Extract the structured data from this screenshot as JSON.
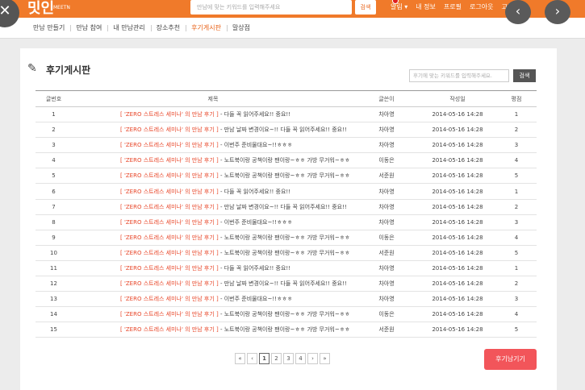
{
  "header": {
    "logo": "밋인",
    "logo_sub": "MEETN",
    "search_placeholder": "만남에 맞는 키워드를 입력해주세요",
    "search_button": "검색",
    "nav": [
      "알림 ▾",
      "내 정보",
      "프로필",
      "로그아웃",
      "고객센터"
    ]
  },
  "subnav": {
    "items": [
      "만남 만들기",
      "만남 참여",
      "내 만남관리",
      "장소추천",
      "후기게시판",
      "말상점"
    ],
    "active_index": 4
  },
  "board": {
    "title": "후기게시판",
    "search_placeholder": "후기에 맞는 키워드를 입력해주세요.",
    "search_button": "검색",
    "columns": [
      "글번호",
      "제목",
      "글쓴이",
      "작성일",
      "평점"
    ],
    "rows": [
      {
        "num": "1",
        "tag": "[ 'ZERO 스트레스 세미나' 의 만남 후기 ]",
        "text": " - 다들 꼭 읽어주세요!! 중요!!",
        "author": "차아영",
        "date": "2014-05-16 14:28",
        "score": "1"
      },
      {
        "num": "2",
        "tag": "[ 'ZERO 스트레스 세미나' 의 만남 후기 ]",
        "text": " - 만남 날짜 변경이요~!! 다들 꼭 읽어주세요!! 중요!!",
        "author": "차아영",
        "date": "2014-05-16 14:28",
        "score": "2"
      },
      {
        "num": "3",
        "tag": "[ 'ZERO 스트레스 세미나' 의 만남 후기 ]",
        "text": " - 이번주 준비물대요~!!ㅎㅎㅎ",
        "author": "차아영",
        "date": "2014-05-16 14:28",
        "score": "3"
      },
      {
        "num": "4",
        "tag": "[ 'ZERO 스트레스 세미나' 의 만남 후기 ]",
        "text": " - 노트북이랑 공책이랑 팬이랑~ㅎㅎ 가방 무거워~ㅎㅎ",
        "author": "이동은",
        "date": "2014-05-16 14:28",
        "score": "4"
      },
      {
        "num": "5",
        "tag": "[ 'ZERO 스트레스 세미나' 의 만남 후기 ]",
        "text": " - 노트북이랑 공책이랑 팬이랑~ㅎㅎ 가방 무거워~ㅎㅎ",
        "author": "서준원",
        "date": "2014-05-16 14:28",
        "score": "5"
      },
      {
        "num": "6",
        "tag": "[ 'ZERO 스트레스 세미나' 의 만남 후기 ]",
        "text": " - 다들 꼭 읽어주세요!! 중요!!",
        "author": "차아영",
        "date": "2014-05-16 14:28",
        "score": "1"
      },
      {
        "num": "7",
        "tag": "[ 'ZERO 스트레스 세미나' 의 만남 후기 ]",
        "text": " - 만남 날짜 변경이요~!! 다들 꼭 읽어주세요!! 중요!!",
        "author": "차아영",
        "date": "2014-05-16 14:28",
        "score": "2"
      },
      {
        "num": "8",
        "tag": "[ 'ZERO 스트레스 세미나' 의 만남 후기 ]",
        "text": " - 이번주 준비물대요~!!ㅎㅎㅎ",
        "author": "차아영",
        "date": "2014-05-16 14:28",
        "score": "3"
      },
      {
        "num": "9",
        "tag": "[ 'ZERO 스트레스 세미나' 의 만남 후기 ]",
        "text": " - 노트북이랑 공책이랑 팬이랑~ㅎㅎ 가방 무거워~ㅎㅎ",
        "author": "이동은",
        "date": "2014-05-16 14:28",
        "score": "4"
      },
      {
        "num": "10",
        "tag": "[ 'ZERO 스트레스 세미나' 의 만남 후기 ]",
        "text": " - 노트북이랑 공책이랑 팬이랑~ㅎㅎ 가방 무거워~ㅎㅎ",
        "author": "서준원",
        "date": "2014-05-16 14:28",
        "score": "5"
      },
      {
        "num": "11",
        "tag": "[ 'ZERO 스트레스 세미나' 의 만남 후기 ]",
        "text": " - 다들 꼭 읽어주세요!! 중요!!",
        "author": "차아영",
        "date": "2014-05-16 14:28",
        "score": "1"
      },
      {
        "num": "12",
        "tag": "[ 'ZERO 스트레스 세미나' 의 만남 후기 ]",
        "text": " - 만남 날짜 변경이요~!! 다들 꼭 읽어주세요!! 중요!!",
        "author": "차아영",
        "date": "2014-05-16 14:28",
        "score": "2"
      },
      {
        "num": "13",
        "tag": "[ 'ZERO 스트레스 세미나' 의 만남 후기 ]",
        "text": " - 이번주 준비물대요~!!ㅎㅎㅎ",
        "author": "차아영",
        "date": "2014-05-16 14:28",
        "score": "3"
      },
      {
        "num": "14",
        "tag": "[ 'ZERO 스트레스 세미나' 의 만남 후기 ]",
        "text": " - 노트북이랑 공책이랑 팬이랑~ㅎㅎ 가방 무거워~ㅎㅎ",
        "author": "이동은",
        "date": "2014-05-16 14:28",
        "score": "4"
      },
      {
        "num": "15",
        "tag": "[ 'ZERO 스트레스 세미나' 의 만남 후기 ]",
        "text": " - 노트북이랑 공책이랑 팬이랑~ㅎㅎ 가방 무거워~ㅎㅎ",
        "author": "서준원",
        "date": "2014-05-16 14:28",
        "score": "5"
      }
    ]
  },
  "pagination": {
    "first": "«",
    "prev": "‹",
    "pages": [
      "1",
      "2",
      "3",
      "4"
    ],
    "current": "1",
    "next": "›",
    "last": "»"
  },
  "write_button": "후기남기기",
  "overlay": {
    "close": "✕",
    "prev": "‹",
    "next": "›"
  },
  "colors": {
    "brand": "#f07a2a",
    "tag": "#e8472a",
    "write_button": "#f2555a"
  }
}
